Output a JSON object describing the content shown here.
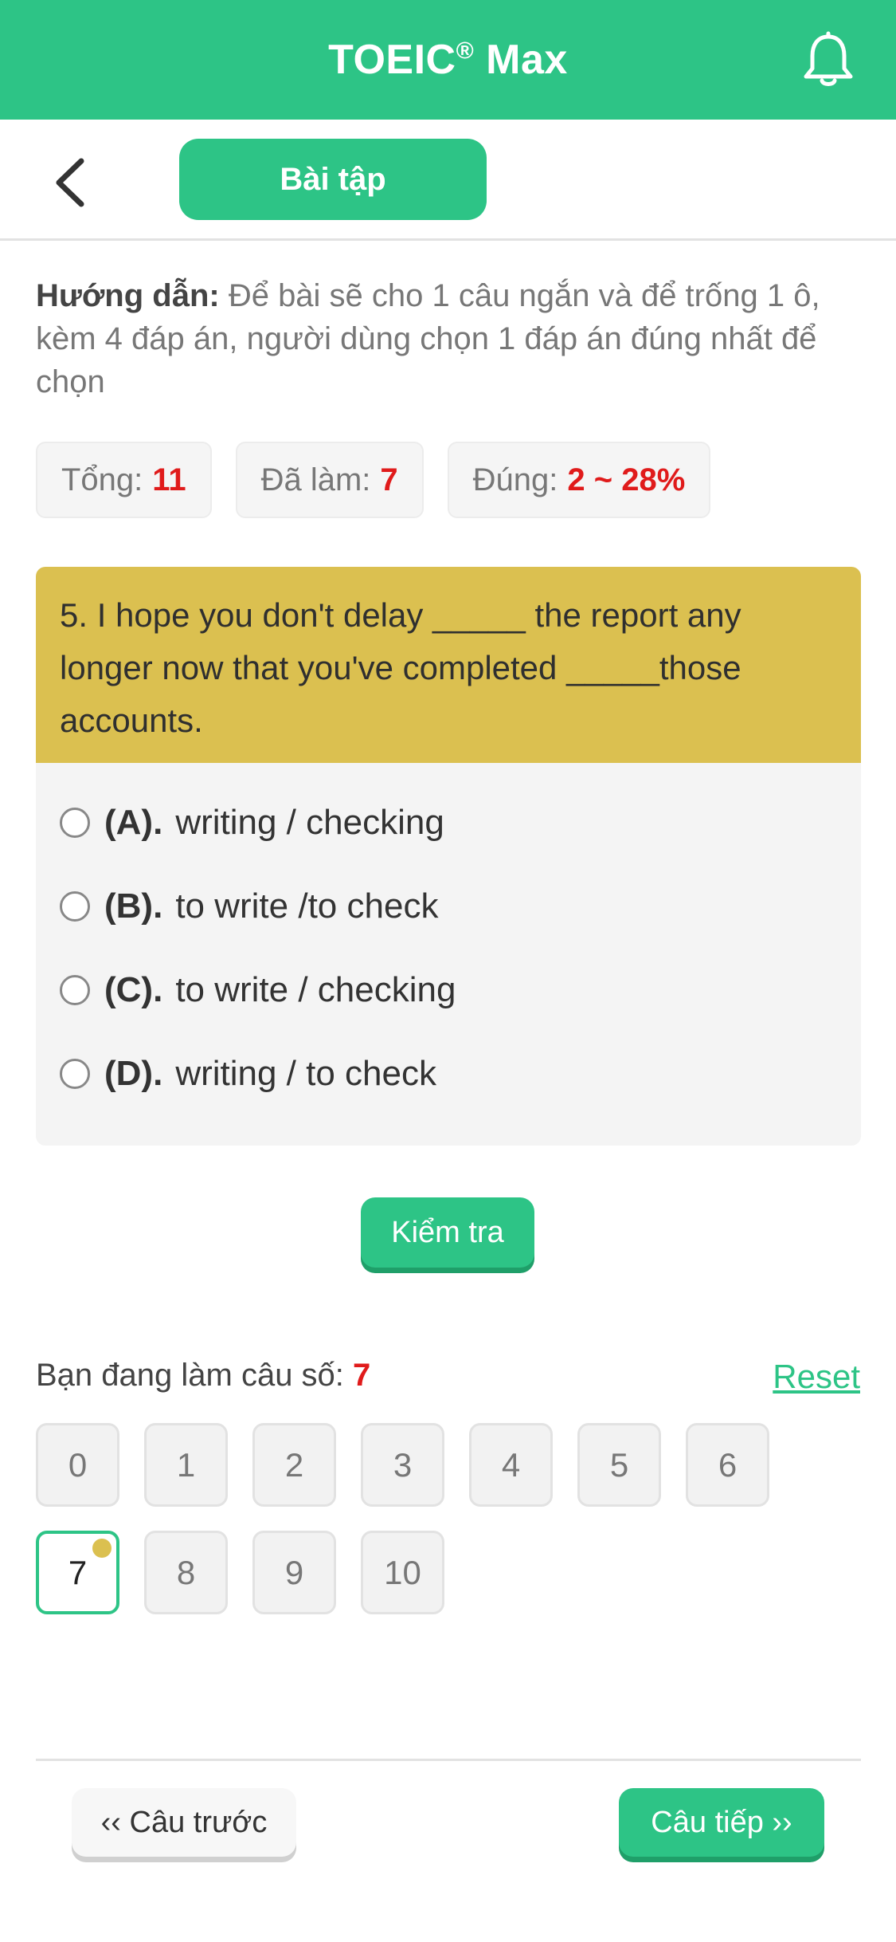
{
  "header": {
    "title": "TOEIC",
    "title_mark": "®",
    "title_suffix": " Max",
    "bell_icon": "bell-icon"
  },
  "subheader": {
    "back_icon": "chevron-left-icon",
    "tab_label": "Bài tập"
  },
  "instructions": {
    "label": "Hướng dẫn:",
    "text": " Để bài sẽ cho 1 câu ngắn và để trống 1 ô, kèm 4 đáp án, người dùng chọn 1 đáp án đúng nhất để chọn"
  },
  "stats": {
    "total_label": "Tổng:",
    "total_value": "11",
    "done_label": "Đã làm:",
    "done_value": "7",
    "correct_label": "Đúng:",
    "correct_value": "2 ~ 28%"
  },
  "question": {
    "text": "5. I hope you don't delay _____ the report any longer now that you've completed _____those accounts."
  },
  "options": [
    {
      "letter": "(A).",
      "text": "writing / checking"
    },
    {
      "letter": "(B).",
      "text": "to write /to check"
    },
    {
      "letter": "(C).",
      "text": "to write / checking"
    },
    {
      "letter": "(D).",
      "text": "writing / to check"
    }
  ],
  "check_button": "Kiểm tra",
  "progress": {
    "label": "Bạn đang làm câu số:",
    "current": "7",
    "reset": "Reset",
    "numbers": [
      "0",
      "1",
      "2",
      "3",
      "4",
      "5",
      "6",
      "7",
      "8",
      "9",
      "10"
    ]
  },
  "nav": {
    "prev": "‹‹ Câu trước",
    "next": "Câu tiếp ››"
  },
  "colors": {
    "brand": "#2dc486",
    "question_bg": "#dbc050",
    "highlight": "#e01b1b"
  }
}
